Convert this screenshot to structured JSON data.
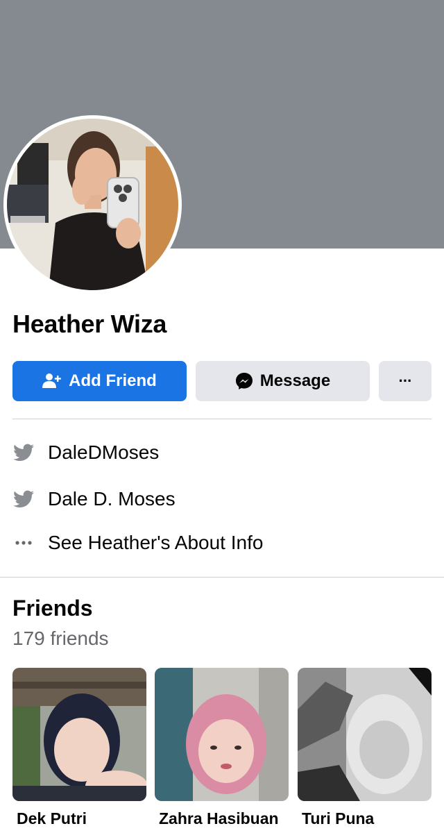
{
  "profile": {
    "name": "Heather Wiza"
  },
  "actions": {
    "add_friend_label": "Add Friend",
    "message_label": "Message",
    "more_label": "···"
  },
  "info": {
    "items": [
      {
        "icon": "twitter-icon",
        "text": "DaleDMoses"
      },
      {
        "icon": "twitter-icon",
        "text": "Dale D. Moses"
      },
      {
        "icon": "more-dots-icon",
        "text": "See Heather's About Info"
      }
    ]
  },
  "friends": {
    "title": "Friends",
    "count_label": "179 friends",
    "items": [
      {
        "name": "Dek Putri"
      },
      {
        "name": "Zahra Hasibuan"
      },
      {
        "name": "Turi Puna"
      }
    ]
  },
  "colors": {
    "primary_button": "#1b74e4",
    "secondary_button": "#e4e6eb",
    "cover": "#858a90",
    "muted_text": "#65676b",
    "icon_gray": "#8a8d91"
  }
}
